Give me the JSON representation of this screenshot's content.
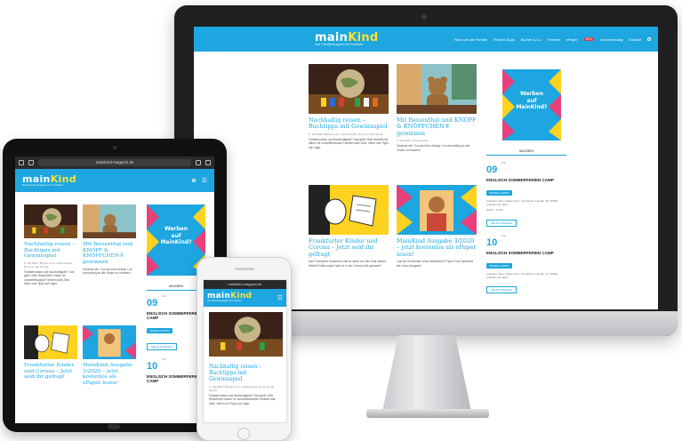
{
  "colors": {
    "brand": "#1da6df",
    "accent_yellow": "#f7e23c",
    "ad_pink": "#e8407b",
    "ad_yellow": "#ffd21f",
    "badge_red": "#e7313e"
  },
  "site": {
    "logo_main": "main",
    "logo_accent": "Kind",
    "logo_tagline": "Das Familienmagazin für Frankfurt",
    "nav": [
      "Rund um die Familie",
      "Freizeit-Tipps",
      "Bücher & Co",
      "Termine",
      "ePaper",
      "Lesermeinung",
      "Kontakt"
    ],
    "nav_pill": "NEU"
  },
  "articles": [
    {
      "title": "Nachhaltig reisen – Buchtipps mit Gewinnspiel",
      "meta": "6. Juli 2020 | Bücher & Co, Gewinnspiele, Rund um die Familie",
      "excerpt": "Familienurlaub und Nachhaltigkeit? Das geht! Viele Reiseführer haben für umweltbewusste Familien tolle Ziele, Ideen und Tipps auf Lager."
    },
    {
      "title": "Mit Beisenthal und KNOPF & KNÖPFCHEN® gewinnen",
      "meta": "3. Juli 2020 | Gewinnspiele",
      "excerpt": "Gewusst wie: Corona-Krise drängt: Los schnurstrig an alle Kinder zu erwarten."
    },
    {
      "title": "Frankfurter Kinder und Corona – Jetzt seid ihr gefragt",
      "meta": "1. Juli 2020 | Rund um die Familie, Aktuelles",
      "excerpt": "Das Frankfurter Kinderbüro will es direkt von den Kids wissen: Welche Erfahrungen habt ihr in der Corona-Zeit gemacht?"
    },
    {
      "title": "MainKind Ausgabe 3/2020 – jetzt kostenlos als ePaper lesen!",
      "meta": "29. Juni 2020 | Aktuelles, Magazin",
      "excerpt": "Lust bei Großkinder unser MainKind-E-Paper: Das Topthema der neuen Ausgabe."
    }
  ],
  "ad": {
    "line1": "Werben",
    "line2": "auf",
    "line3": "MainKind?"
  },
  "sidebar": {
    "tab": "ABLEBEN"
  },
  "events": [
    {
      "day": "09",
      "mon": "JUL",
      "title": "ENGLISCH SOMMERFERIEN CAMP",
      "badge": "FERIEN-CAMPS",
      "text": "Frankfurt Cheer Natte Kortur: Frankfurter Landstr. 25, 60599 Frankfurt am Main",
      "time": "09:00 – 15:00",
      "more": "MEHR ANSEHEN"
    },
    {
      "day": "10",
      "mon": "JUL",
      "title": "ENGLISCH SOMMERFERIEN CAMP",
      "badge": "FERIEN-CAMPS",
      "text": "Frankfurt Cheer Natte Kortur: Frankfurter Landstr. 25, 60599 Frankfurt am Main",
      "time": "09:00 – 15:00",
      "more": "MEHR ANSEHEN"
    }
  ],
  "ipad": {
    "url": "mainkind-magazin.de"
  },
  "iphone": {
    "url": "mainkind-magazin.de"
  }
}
